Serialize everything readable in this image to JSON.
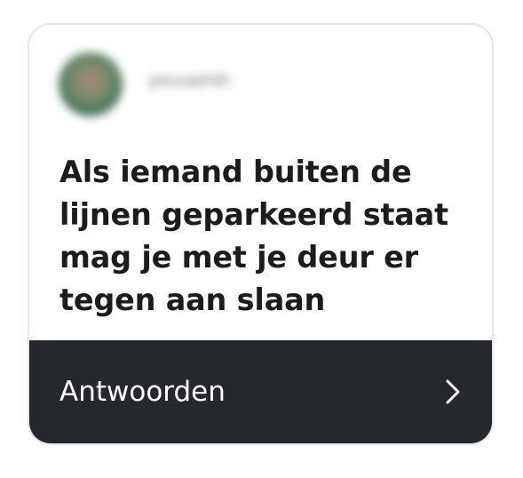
{
  "post": {
    "author": {
      "username": "pmzaehth",
      "avatar_icon": "user-avatar-blurred"
    },
    "question": "Als iemand buiten de lijnen geparkeerd staat mag je met je deur er tegen aan slaan"
  },
  "footer": {
    "reply_label": "Antwoorden",
    "chevron_icon": "chevron-right-icon"
  },
  "colors": {
    "footer_bg": "#25282d",
    "text_primary": "#1c1c1e",
    "card_border": "#e6e6e6"
  }
}
